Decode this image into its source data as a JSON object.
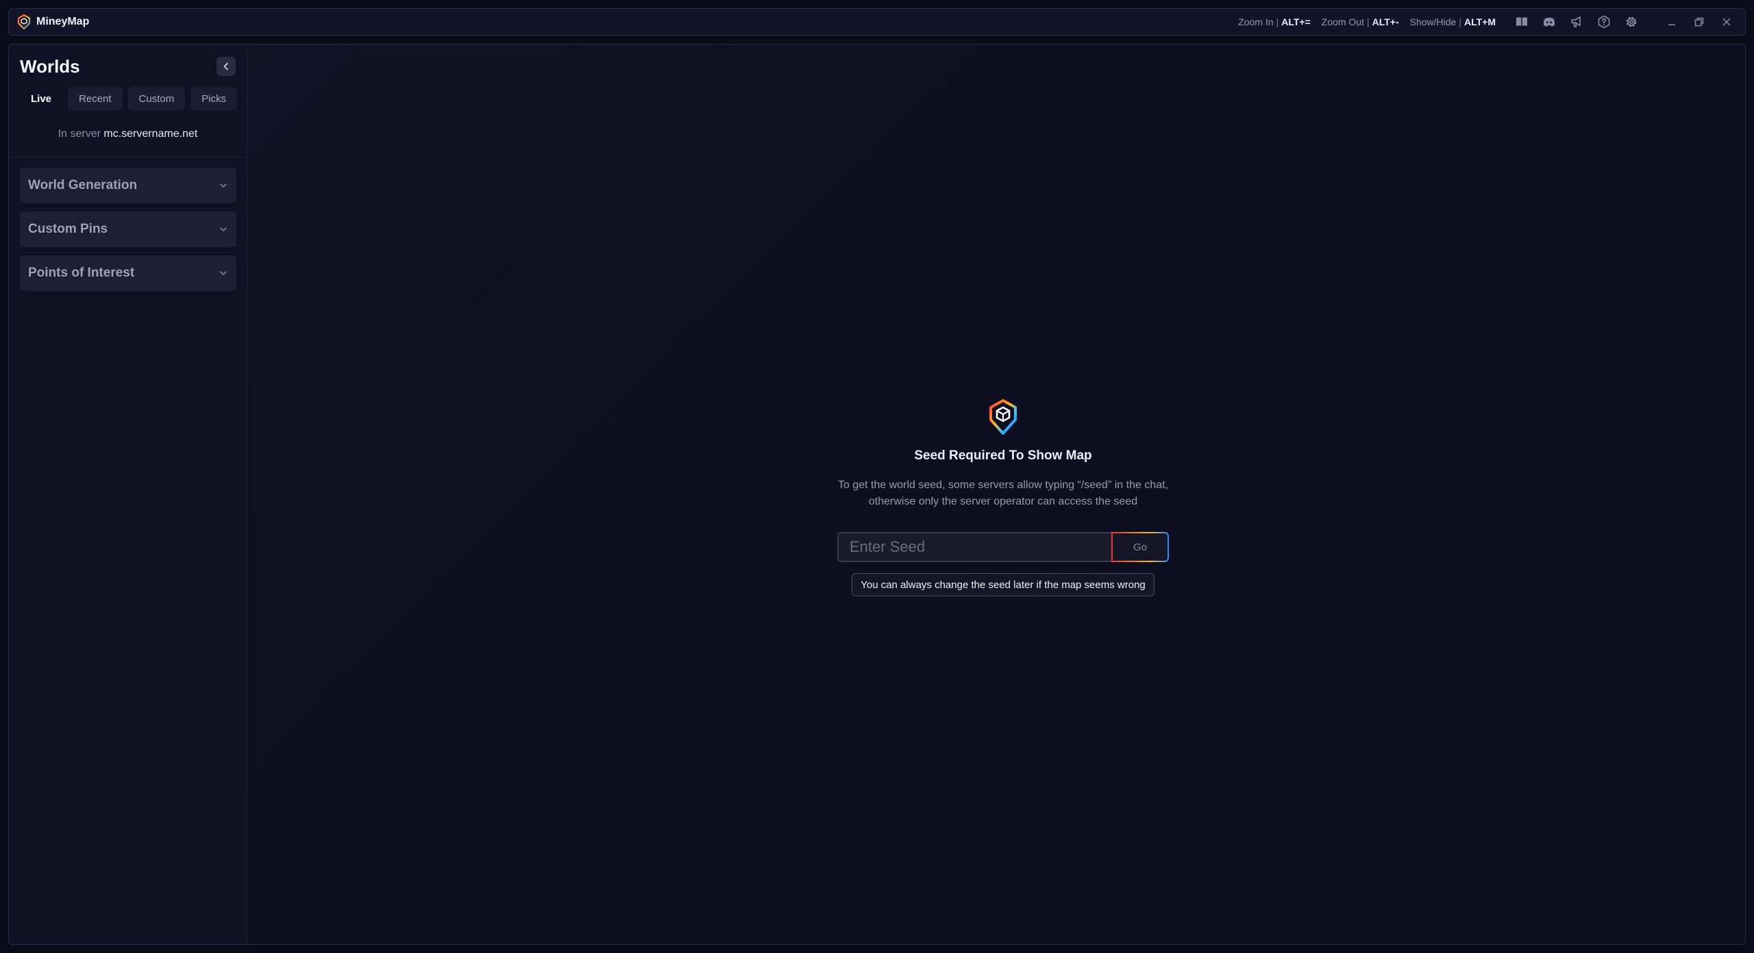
{
  "app": {
    "title": "MineyMap"
  },
  "shortcuts": [
    {
      "label": "Zoom In",
      "key": "ALT+="
    },
    {
      "label": "Zoom Out",
      "key": "ALT+-"
    },
    {
      "label": "Show/Hide",
      "key": "ALT+M"
    }
  ],
  "toolbar_icons": [
    "book-icon",
    "discord-icon",
    "megaphone-icon",
    "help-icon",
    "gear-icon"
  ],
  "sidebar": {
    "title": "Worlds",
    "tabs": [
      {
        "label": "Live",
        "active": true
      },
      {
        "label": "Recent",
        "active": false
      },
      {
        "label": "Custom",
        "active": false
      },
      {
        "label": "Picks",
        "active": false
      }
    ],
    "server_prefix": "In server",
    "server_name": "mc.servername.net",
    "sections": [
      {
        "label": "World Generation"
      },
      {
        "label": "Custom Pins"
      },
      {
        "label": "Points of Interest"
      }
    ]
  },
  "center": {
    "title": "Seed Required To Show Map",
    "description": "To get the world seed, some servers allow typing “/seed” in the chat, otherwise only the server operator can access the seed",
    "seed_placeholder": "Enter Seed",
    "seed_value": "",
    "go_label": "Go",
    "hint": "You can always change the seed later if the map seems wrong"
  },
  "colors": {
    "background": "#0b0b1a",
    "panel": "#111126",
    "accent_gradient": [
      "#e03a3a",
      "#f0a020",
      "#2a8aff"
    ]
  }
}
